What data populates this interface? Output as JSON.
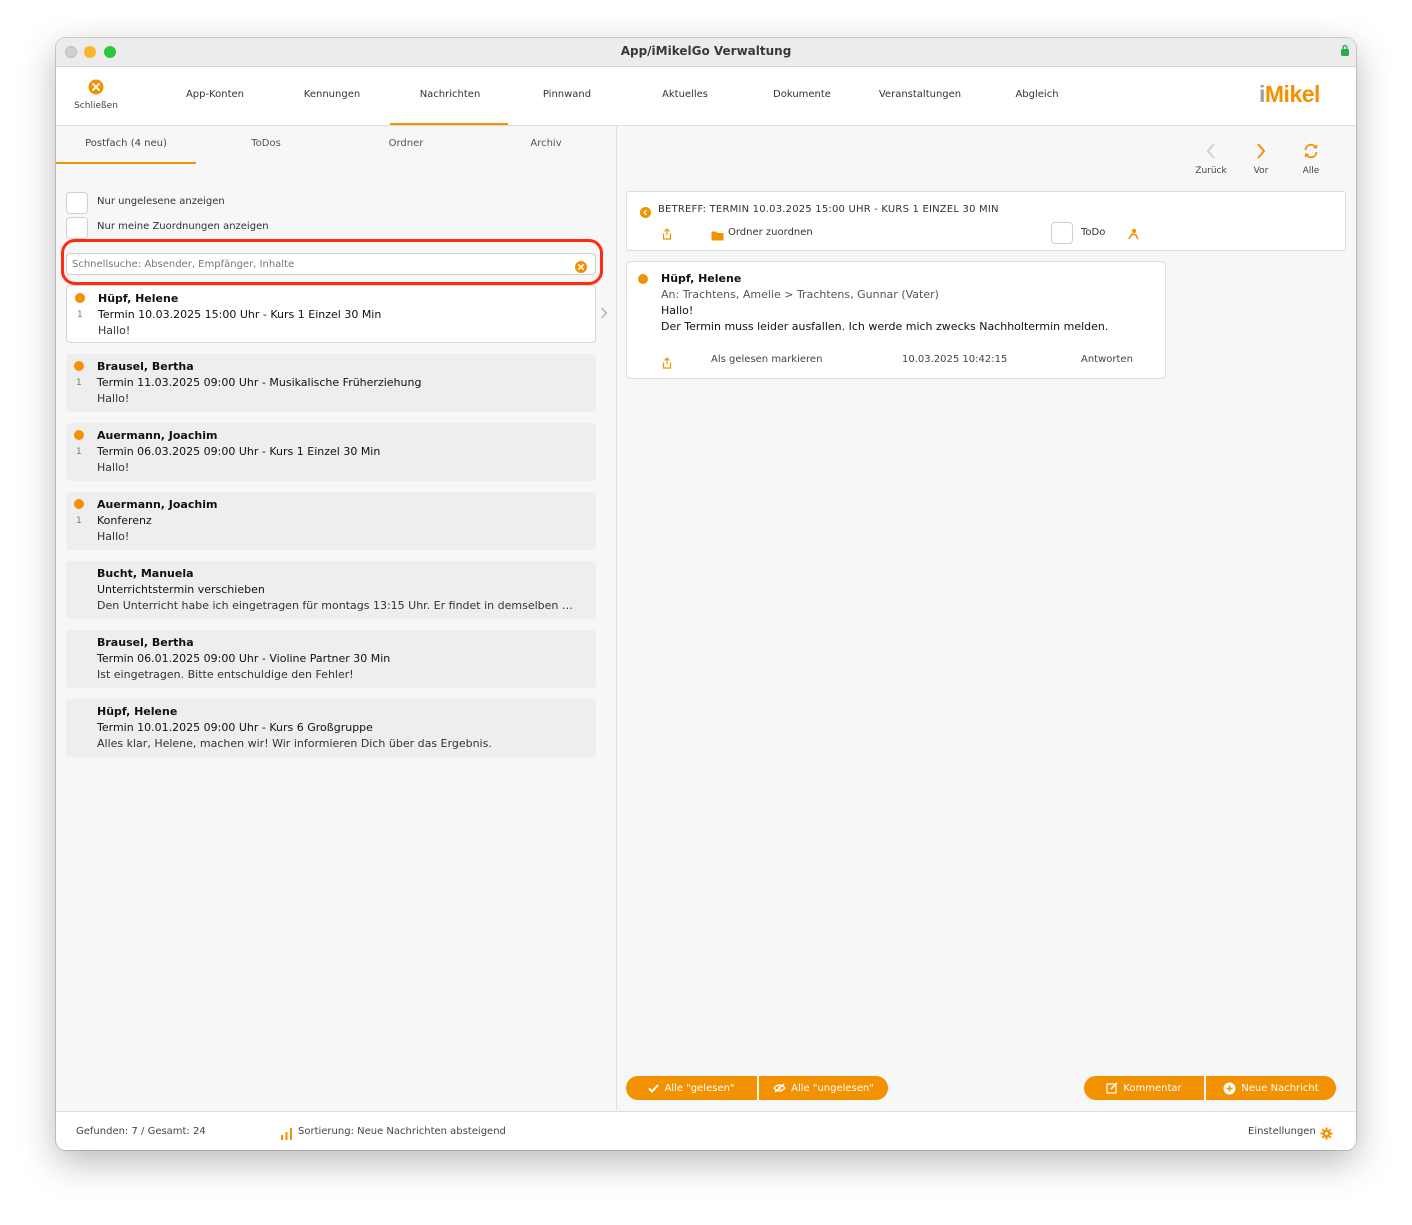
{
  "window": {
    "title": "App/iMikelGo Verwaltung"
  },
  "toolbar": {
    "close_label": "Schließen",
    "nav": [
      "App-Konten",
      "Kennungen",
      "Nachrichten",
      "Pinnwand",
      "Aktuelles",
      "Dokumente",
      "Veranstaltungen",
      "Abgleich"
    ],
    "active_nav": "Nachrichten",
    "brand": {
      "prefix": "i",
      "name": "Mikel"
    },
    "accent_color": "#f39200"
  },
  "left": {
    "tabs": [
      "Postfach (4 neu)",
      "ToDos",
      "Ordner",
      "Archiv"
    ],
    "active_tab": "Postfach (4 neu)",
    "filters": {
      "unread_only": "Nur ungelesene anzeigen",
      "my_assignments": "Nur meine Zuordnungen anzeigen"
    },
    "search": {
      "placeholder": "Schnellsuche: Absender, Empfänger, Inhalte",
      "value": ""
    },
    "messages": [
      {
        "unread": true,
        "count": "1",
        "sender": "Hüpf, Helene",
        "subject": "Termin 10.03.2025 15:00 Uhr - Kurs 1 Einzel 30 Min",
        "preview": "Hallo!",
        "selected": true
      },
      {
        "unread": true,
        "count": "1",
        "sender": "Brausel, Bertha",
        "subject": "Termin 11.03.2025 09:00 Uhr - Musikalische Früherziehung",
        "preview": "Hallo!"
      },
      {
        "unread": true,
        "count": "1",
        "sender": "Auermann, Joachim",
        "subject": "Termin 06.03.2025 09:00 Uhr - Kurs 1 Einzel 30 Min",
        "preview": "Hallo!"
      },
      {
        "unread": true,
        "count": "1",
        "sender": "Auermann, Joachim",
        "subject": "Konferenz",
        "preview": "Hallo!"
      },
      {
        "unread": false,
        "count": "",
        "sender": "Bucht, Manuela",
        "subject": "Unterrichtstermin verschieben",
        "preview": "Den Unterricht habe ich eingetragen für montags 13:15 Uhr. Er findet in demselben …"
      },
      {
        "unread": false,
        "count": "",
        "sender": "Brausel, Bertha",
        "subject": "Termin 06.01.2025 09:00 Uhr - Violine Partner 30 Min",
        "preview": "Ist eingetragen. Bitte entschuldige den Fehler!"
      },
      {
        "unread": false,
        "count": "",
        "sender": "Hüpf, Helene",
        "subject": "Termin 10.01.2025 09:00 Uhr - Kurs 6 Großgruppe",
        "preview": "Alles klar, Helene, machen wir! Wir informieren Dich über das Ergebnis."
      }
    ]
  },
  "right": {
    "nav": {
      "back": "Zurück",
      "forward": "Vor",
      "all": "Alle"
    },
    "subject_bar": {
      "subject": "BETREFF: TERMIN 10.03.2025 15:00 UHR - KURS 1 EINZEL 30 MIN",
      "assign_folder": "Ordner zuordnen",
      "todo_label": "ToDo"
    },
    "detail": {
      "sender": "Hüpf, Helene",
      "recipients": "An: Trachtens, Amelie > Trachtens, Gunnar (Vater)",
      "body_line1": "Hallo!",
      "body_line2": "Der Termin muss leider ausfallen. Ich werde mich zwecks Nachholtermin melden.",
      "mark_read": "Als gelesen markieren",
      "timestamp": "10.03.2025 10:42:15",
      "reply": "Antworten"
    },
    "buttons": {
      "all_read": "Alle \"gelesen\"",
      "all_unread": "Alle \"ungelesen\"",
      "comment": "Kommentar",
      "new_message": "Neue Nachricht"
    }
  },
  "status": {
    "found": "Gefunden: 7 / Gesamt: 24",
    "sorting": "Sortierung: Neue Nachrichten absteigend",
    "settings": "Einstellungen"
  }
}
